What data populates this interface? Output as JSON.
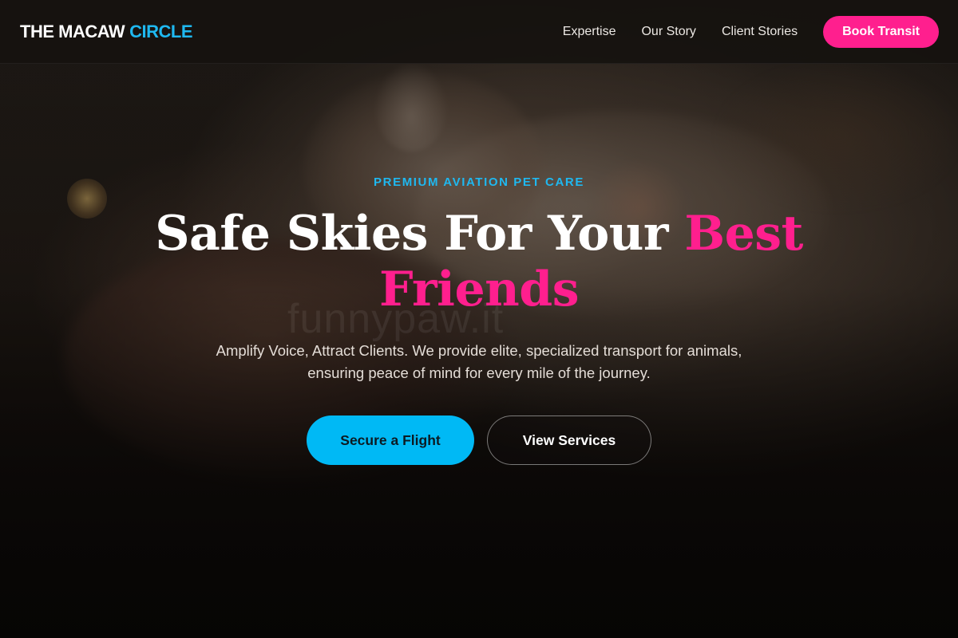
{
  "brand": {
    "name": "THE MACAW",
    "accent": "CIRCLE",
    "accent_color": "#1fb8f0"
  },
  "nav": {
    "links": [
      "Expertise",
      "Our Story",
      "Client Stories"
    ],
    "cta_label": "Book Transit",
    "cta_color": "#ff1f8e"
  },
  "hero": {
    "eyebrow": "PREMIUM AVIATION PET CARE",
    "headline_main": "Safe Skies For Your ",
    "headline_accent": "Best Friends",
    "headline_accent_color": "#ff1f8e",
    "subtext": "Amplify Voice, Attract Clients. We provide elite, specialized transport for animals, ensuring peace of mind for every mile of the journey.",
    "primary_button": "Secure a Flight",
    "primary_color": "#00b9f5",
    "secondary_button": "View Services",
    "watermark": "funnypaw.it"
  }
}
